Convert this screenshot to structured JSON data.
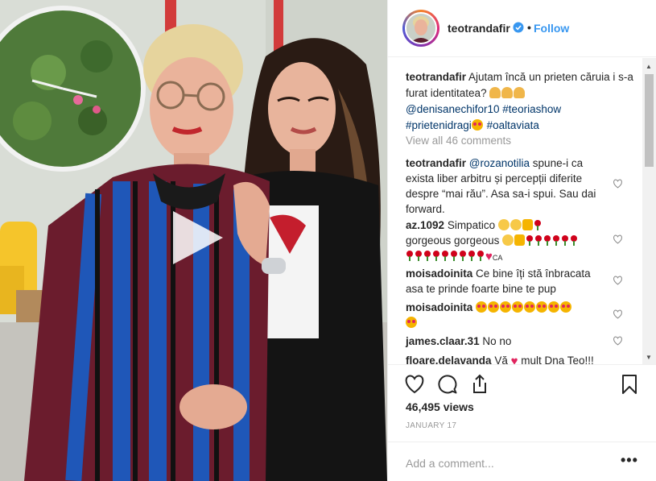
{
  "post": {
    "username": "teotrandafir",
    "follow_label": "Follow",
    "dot": "•",
    "verified_icon": "verified-badge-icon",
    "accent_color": "#3897f0"
  },
  "caption": {
    "username": "teotrandafir",
    "text": "Ajutam încă un prieten căruia i s-a furat identitatea?",
    "mentions": [
      "@denisanechifor10",
      "#teoriashow",
      "#prietenidragi",
      "#oaltaviata"
    ]
  },
  "view_all": "View all 46 comments",
  "comments": [
    {
      "username": "teotrandafir",
      "mention": "@rozanotilia",
      "text": "spune-i ca exista liber arbitru și percepții diferite despre “mai rău”. Asa sa-i spui. Sau dai forward."
    },
    {
      "username": "az.1092",
      "text": "Simpatico",
      "text2": "gorgeous gorgeous",
      "suffix": "CA"
    },
    {
      "username": "moisadoinita",
      "text": "Ce bine îți stă înbracata asa te prinde foarte bine te pup"
    },
    {
      "username": "moisadoinita",
      "text": ""
    },
    {
      "username": "james.claar.31",
      "text": "No no"
    },
    {
      "username": "floare.delavanda",
      "text": "Vă",
      "text2": "mult Dna Teo!!!"
    }
  ],
  "stats": {
    "views": "46,495 views",
    "date": "JANUARY 17"
  },
  "add_comment": {
    "placeholder": "Add a comment...",
    "more": "•••"
  },
  "icons": {
    "like": "heart-icon",
    "comment": "comment-icon",
    "share": "share-icon",
    "save": "bookmark-icon",
    "play": "play-icon"
  }
}
